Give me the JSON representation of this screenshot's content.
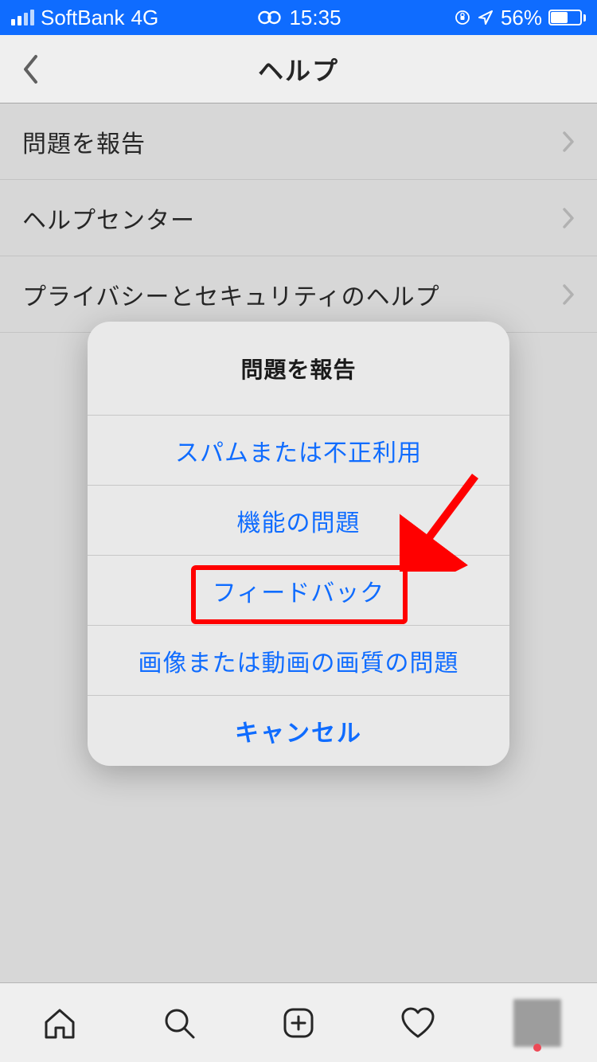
{
  "status": {
    "carrier": "SoftBank",
    "network": "4G",
    "time": "15:35",
    "battery_pct": "56%"
  },
  "header": {
    "title": "ヘルプ"
  },
  "list": {
    "items": [
      {
        "label": "問題を報告"
      },
      {
        "label": "ヘルプセンター"
      },
      {
        "label": "プライバシーとセキュリティのヘルプ"
      }
    ]
  },
  "sheet": {
    "title": "問題を報告",
    "options": [
      {
        "label": "スパムまたは不正利用"
      },
      {
        "label": "機能の問題"
      },
      {
        "label": "フィードバック"
      },
      {
        "label": "画像または動画の画質の問題"
      }
    ],
    "cancel": "キャンセル"
  },
  "annotation": {
    "highlighted_option_index": 2
  }
}
